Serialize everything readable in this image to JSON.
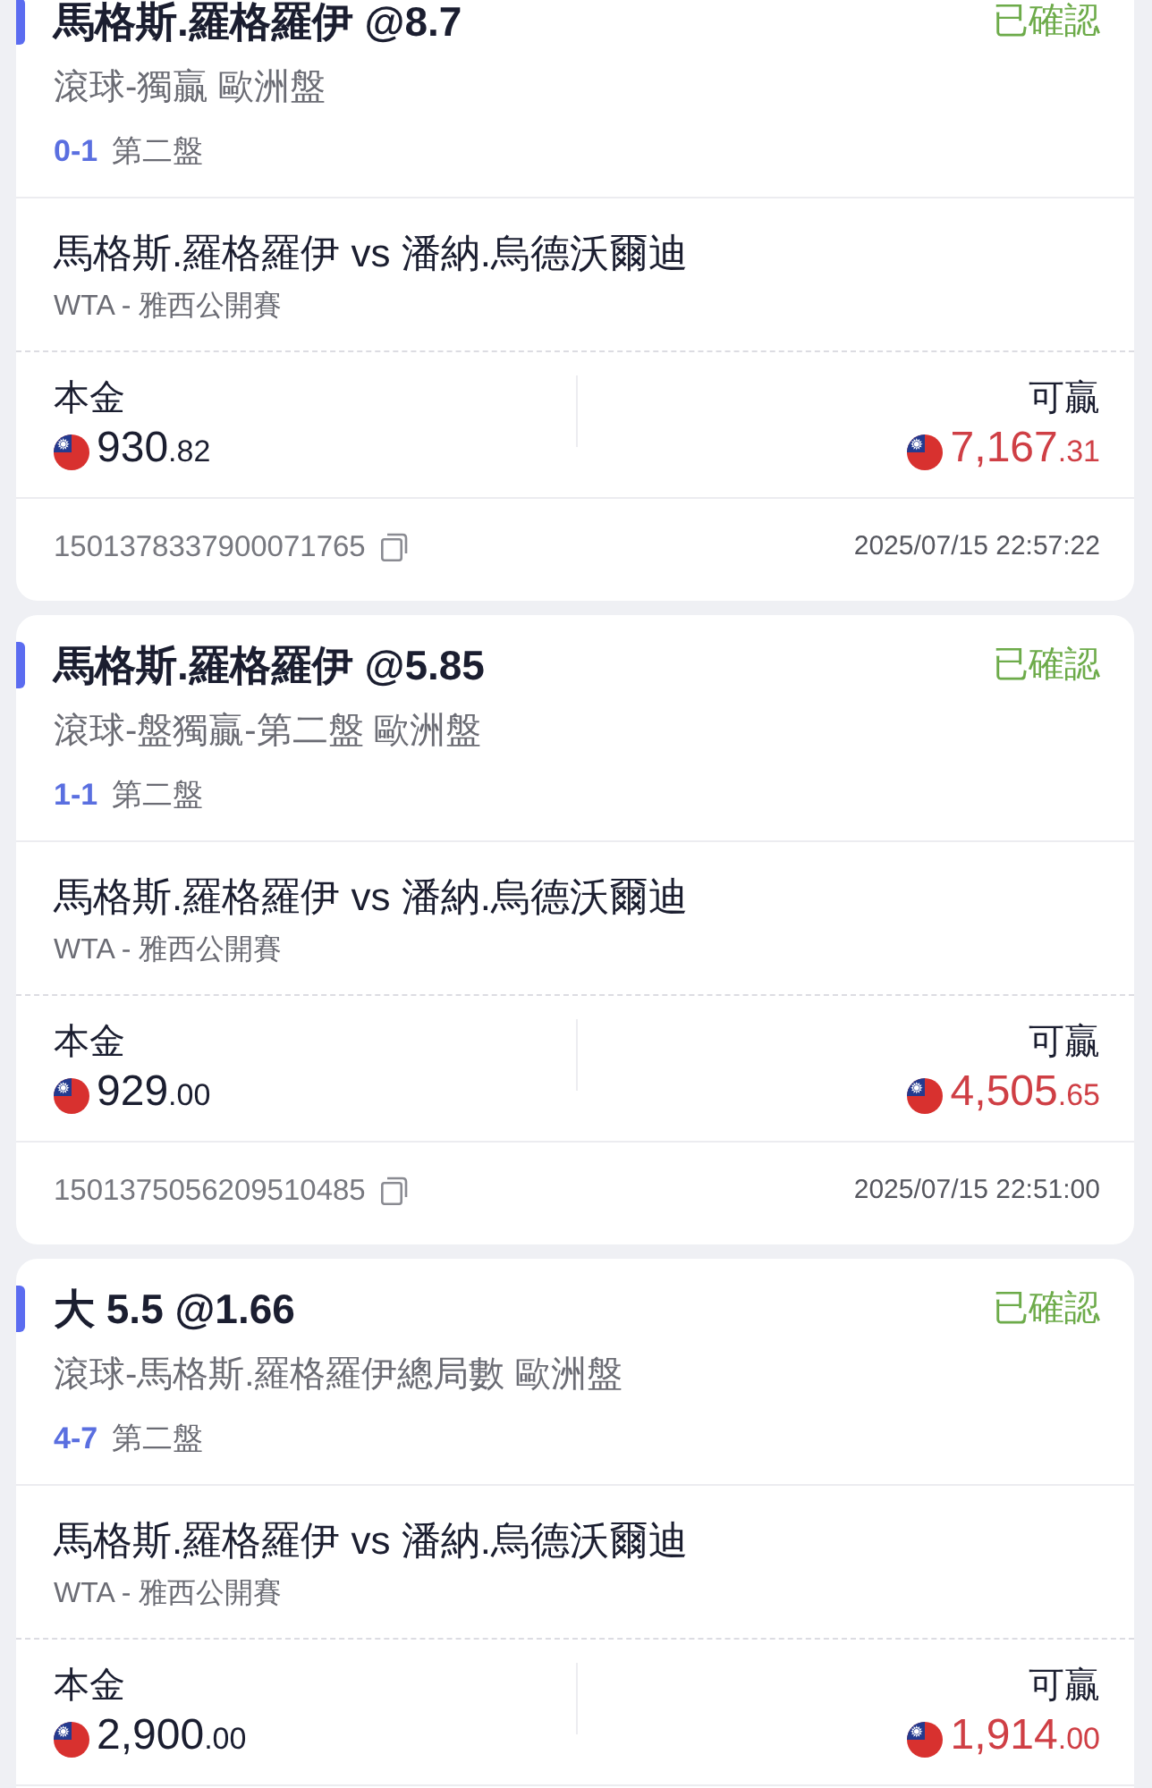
{
  "bets": [
    {
      "selection": "馬格斯.羅格羅伊 @8.7",
      "status": "已確認",
      "market": "滾球-獨贏 歐洲盤",
      "score": "0-1",
      "period": "第二盤",
      "match": "馬格斯.羅格羅伊 vs 潘納.烏德沃爾迪",
      "league": "WTA - 雅西公開賽",
      "stake": {
        "label": "本金",
        "amount": "930.82"
      },
      "payout": {
        "label": "可贏",
        "amount": "7,167.31"
      },
      "ticket_id": "1501378337900071765",
      "placed_at": "2025/07/15 22:57:22"
    },
    {
      "selection": "馬格斯.羅格羅伊 @5.85",
      "status": "已確認",
      "market": "滾球-盤獨贏-第二盤 歐洲盤",
      "score": "1-1",
      "period": "第二盤",
      "match": "馬格斯.羅格羅伊 vs 潘納.烏德沃爾迪",
      "league": "WTA - 雅西公開賽",
      "stake": {
        "label": "本金",
        "amount": "929.00"
      },
      "payout": {
        "label": "可贏",
        "amount": "4,505.65"
      },
      "ticket_id": "1501375056209510485",
      "placed_at": "2025/07/15 22:51:00"
    },
    {
      "selection": "大 5.5 @1.66",
      "status": "已確認",
      "market": "滾球-馬格斯.羅格羅伊總局數 歐洲盤",
      "score": "4-7",
      "period": "第二盤",
      "match": "馬格斯.羅格羅伊 vs 潘納.烏德沃爾迪",
      "league": "WTA - 雅西公開賽",
      "stake": {
        "label": "本金",
        "amount": "2,900.00"
      },
      "payout": {
        "label": "可贏",
        "amount": "1,914.00"
      }
    }
  ]
}
